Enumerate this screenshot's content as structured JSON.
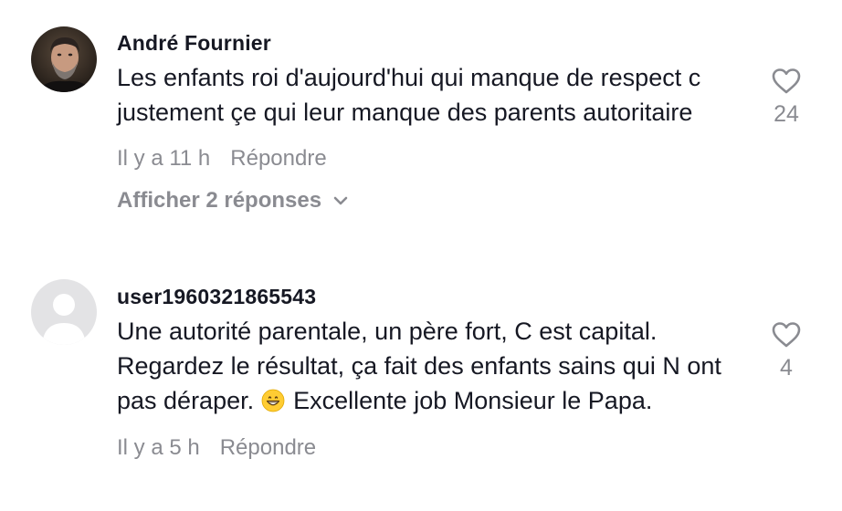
{
  "comments": [
    {
      "username": "André Fournier",
      "text": "Les enfants roi d'aujourd'hui qui manque de respect c justement çe qui leur manque des parents autoritaire",
      "time": "Il y a 11 h",
      "reply_label": "Répondre",
      "likes": "24",
      "show_replies": "Afficher 2 réponses",
      "avatar": "profile-photo-icon"
    },
    {
      "username": "user1960321865543",
      "text_before_emoji": "Une autorité parentale, un père fort, C est capital. Regardez le résultat, ça fait des enfants sains qui N ont pas déraper. ",
      "emoji": "grinning-face-icon",
      "text_after_emoji": " Excellente job Monsieur le Papa.",
      "time": "Il y a 5 h",
      "reply_label": "Répondre",
      "likes": "4",
      "avatar": "default-avatar-icon"
    }
  ],
  "colors": {
    "text": "#161823",
    "muted": "#8a8b91",
    "avatar_placeholder": "#e3e3e5"
  }
}
